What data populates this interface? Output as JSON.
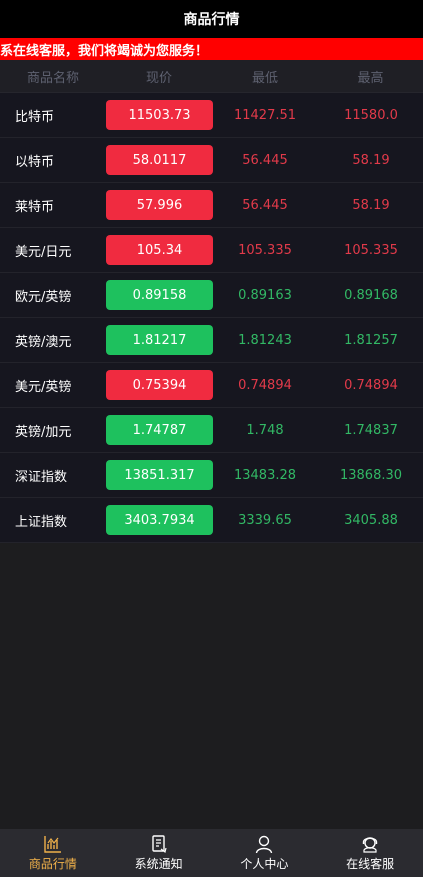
{
  "header": {
    "title": "商品行情"
  },
  "notice": {
    "text": "联系在线客服，我们将竭诚为您服务！"
  },
  "columns": [
    "商品名称",
    "现价",
    "最低",
    "最高"
  ],
  "colors": {
    "up": "#f02b40",
    "down": "#1ec15e",
    "active_tab": "#f0b14a"
  },
  "rows": [
    {
      "name": "比特币",
      "price": "11503.73",
      "low": "11427.51",
      "high": "11580.0",
      "trend": "up"
    },
    {
      "name": "以特币",
      "price": "58.0117",
      "low": "56.445",
      "high": "58.19",
      "trend": "up"
    },
    {
      "name": "莱特币",
      "price": "57.996",
      "low": "56.445",
      "high": "58.19",
      "trend": "up"
    },
    {
      "name": "美元/日元",
      "price": "105.34",
      "low": "105.335",
      "high": "105.335",
      "trend": "up"
    },
    {
      "name": "欧元/英镑",
      "price": "0.89158",
      "low": "0.89163",
      "high": "0.89168",
      "trend": "down"
    },
    {
      "name": "英镑/澳元",
      "price": "1.81217",
      "low": "1.81243",
      "high": "1.81257",
      "trend": "down"
    },
    {
      "name": "美元/英镑",
      "price": "0.75394",
      "low": "0.74894",
      "high": "0.74894",
      "trend": "up"
    },
    {
      "name": "英镑/加元",
      "price": "1.74787",
      "low": "1.748",
      "high": "1.74837",
      "trend": "down"
    },
    {
      "name": "深证指数",
      "price": "13851.317",
      "low": "13483.28",
      "high": "13868.30",
      "trend": "down"
    },
    {
      "name": "上证指数",
      "price": "3403.7934",
      "low": "3339.65",
      "high": "3405.88",
      "trend": "down"
    }
  ],
  "tabs": [
    {
      "label": "商品行情",
      "icon": "chart-icon",
      "active": true
    },
    {
      "label": "系统通知",
      "icon": "notice-icon",
      "active": false
    },
    {
      "label": "个人中心",
      "icon": "user-icon",
      "active": false
    },
    {
      "label": "在线客服",
      "icon": "support-icon",
      "active": false
    }
  ]
}
